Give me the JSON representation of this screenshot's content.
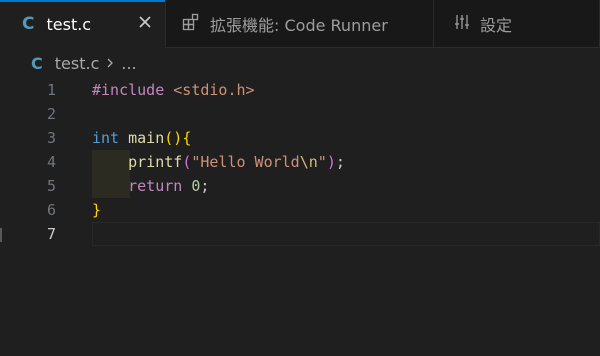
{
  "tabs": [
    {
      "label": "test.c",
      "icon_text": "C",
      "active": true
    },
    {
      "label": "拡張機能: Code Runner",
      "icon": "extensions-icon",
      "active": false
    },
    {
      "label": "設定",
      "icon": "settings-sliders-icon",
      "active": false
    }
  ],
  "breadcrumb": {
    "icon_text": "C",
    "file": "test.c",
    "more": "..."
  },
  "editor": {
    "lines": [
      {
        "n": "1",
        "tokens": [
          {
            "c": "t-pre",
            "t": "#include "
          },
          {
            "c": "t-hdr",
            "t": "<stdio.h>"
          }
        ]
      },
      {
        "n": "2",
        "tokens": []
      },
      {
        "n": "3",
        "tokens": [
          {
            "c": "t-kw",
            "t": "int"
          },
          {
            "c": "",
            "t": " "
          },
          {
            "c": "t-fn",
            "t": "main"
          },
          {
            "c": "t-p1",
            "t": "()"
          },
          {
            "c": "t-p1",
            "t": "{"
          }
        ]
      },
      {
        "n": "4",
        "tokens": [
          {
            "c": "",
            "t": "    "
          },
          {
            "c": "t-fn",
            "t": "printf"
          },
          {
            "c": "t-p2",
            "t": "("
          },
          {
            "c": "t-str",
            "t": "\"Hello World"
          },
          {
            "c": "t-esc",
            "t": "\\n"
          },
          {
            "c": "t-str",
            "t": "\""
          },
          {
            "c": "t-p2",
            "t": ")"
          },
          {
            "c": "",
            "t": ";"
          }
        ]
      },
      {
        "n": "5",
        "tokens": [
          {
            "c": "",
            "t": "    "
          },
          {
            "c": "t-ctl",
            "t": "return"
          },
          {
            "c": "",
            "t": " "
          },
          {
            "c": "t-num",
            "t": "0"
          },
          {
            "c": "",
            "t": ";"
          }
        ]
      },
      {
        "n": "6",
        "tokens": [
          {
            "c": "t-p1",
            "t": "}"
          }
        ]
      },
      {
        "n": "7",
        "tokens": []
      }
    ],
    "current_line": "7"
  },
  "colors": {
    "background": "#1f1f1f",
    "accent": "#0078d4",
    "c_icon": "#519aba"
  }
}
